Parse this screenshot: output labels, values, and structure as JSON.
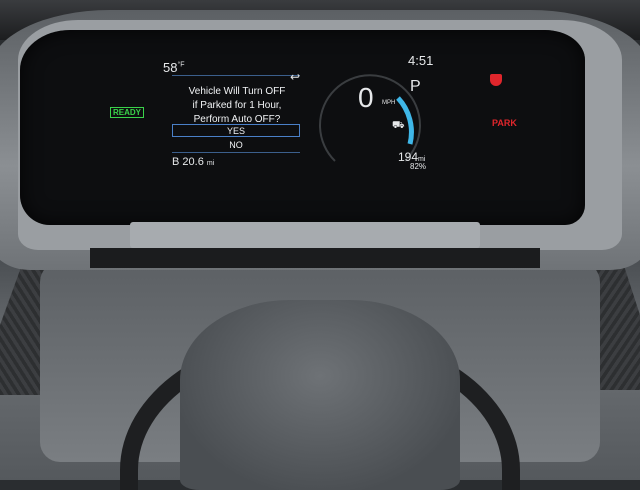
{
  "cluster": {
    "outside_temp": "58",
    "temp_unit": "°F",
    "ready_indicator": "READY",
    "dialog": {
      "line1": "Vehicle Will Turn OFF",
      "line2": "if Parked for 1 Hour,",
      "line3": "Perform Auto OFF?",
      "yes_label": "YES",
      "no_label": "NO",
      "back_icon": "return-icon"
    },
    "odometer_prefix": "B",
    "odometer_value": "20.6",
    "odometer_unit": "mi",
    "clock": "4:51",
    "speed": "0",
    "speed_unit": "MPH",
    "gear": "P",
    "range_value": "194",
    "range_unit": "mi",
    "battery_percent": "82%",
    "park_label": "PARK",
    "colors": {
      "ready_green": "#3ad24a",
      "park_red": "#e0262c",
      "gauge_blue": "#3fb7e8",
      "selection_border": "#4a80c8"
    }
  }
}
